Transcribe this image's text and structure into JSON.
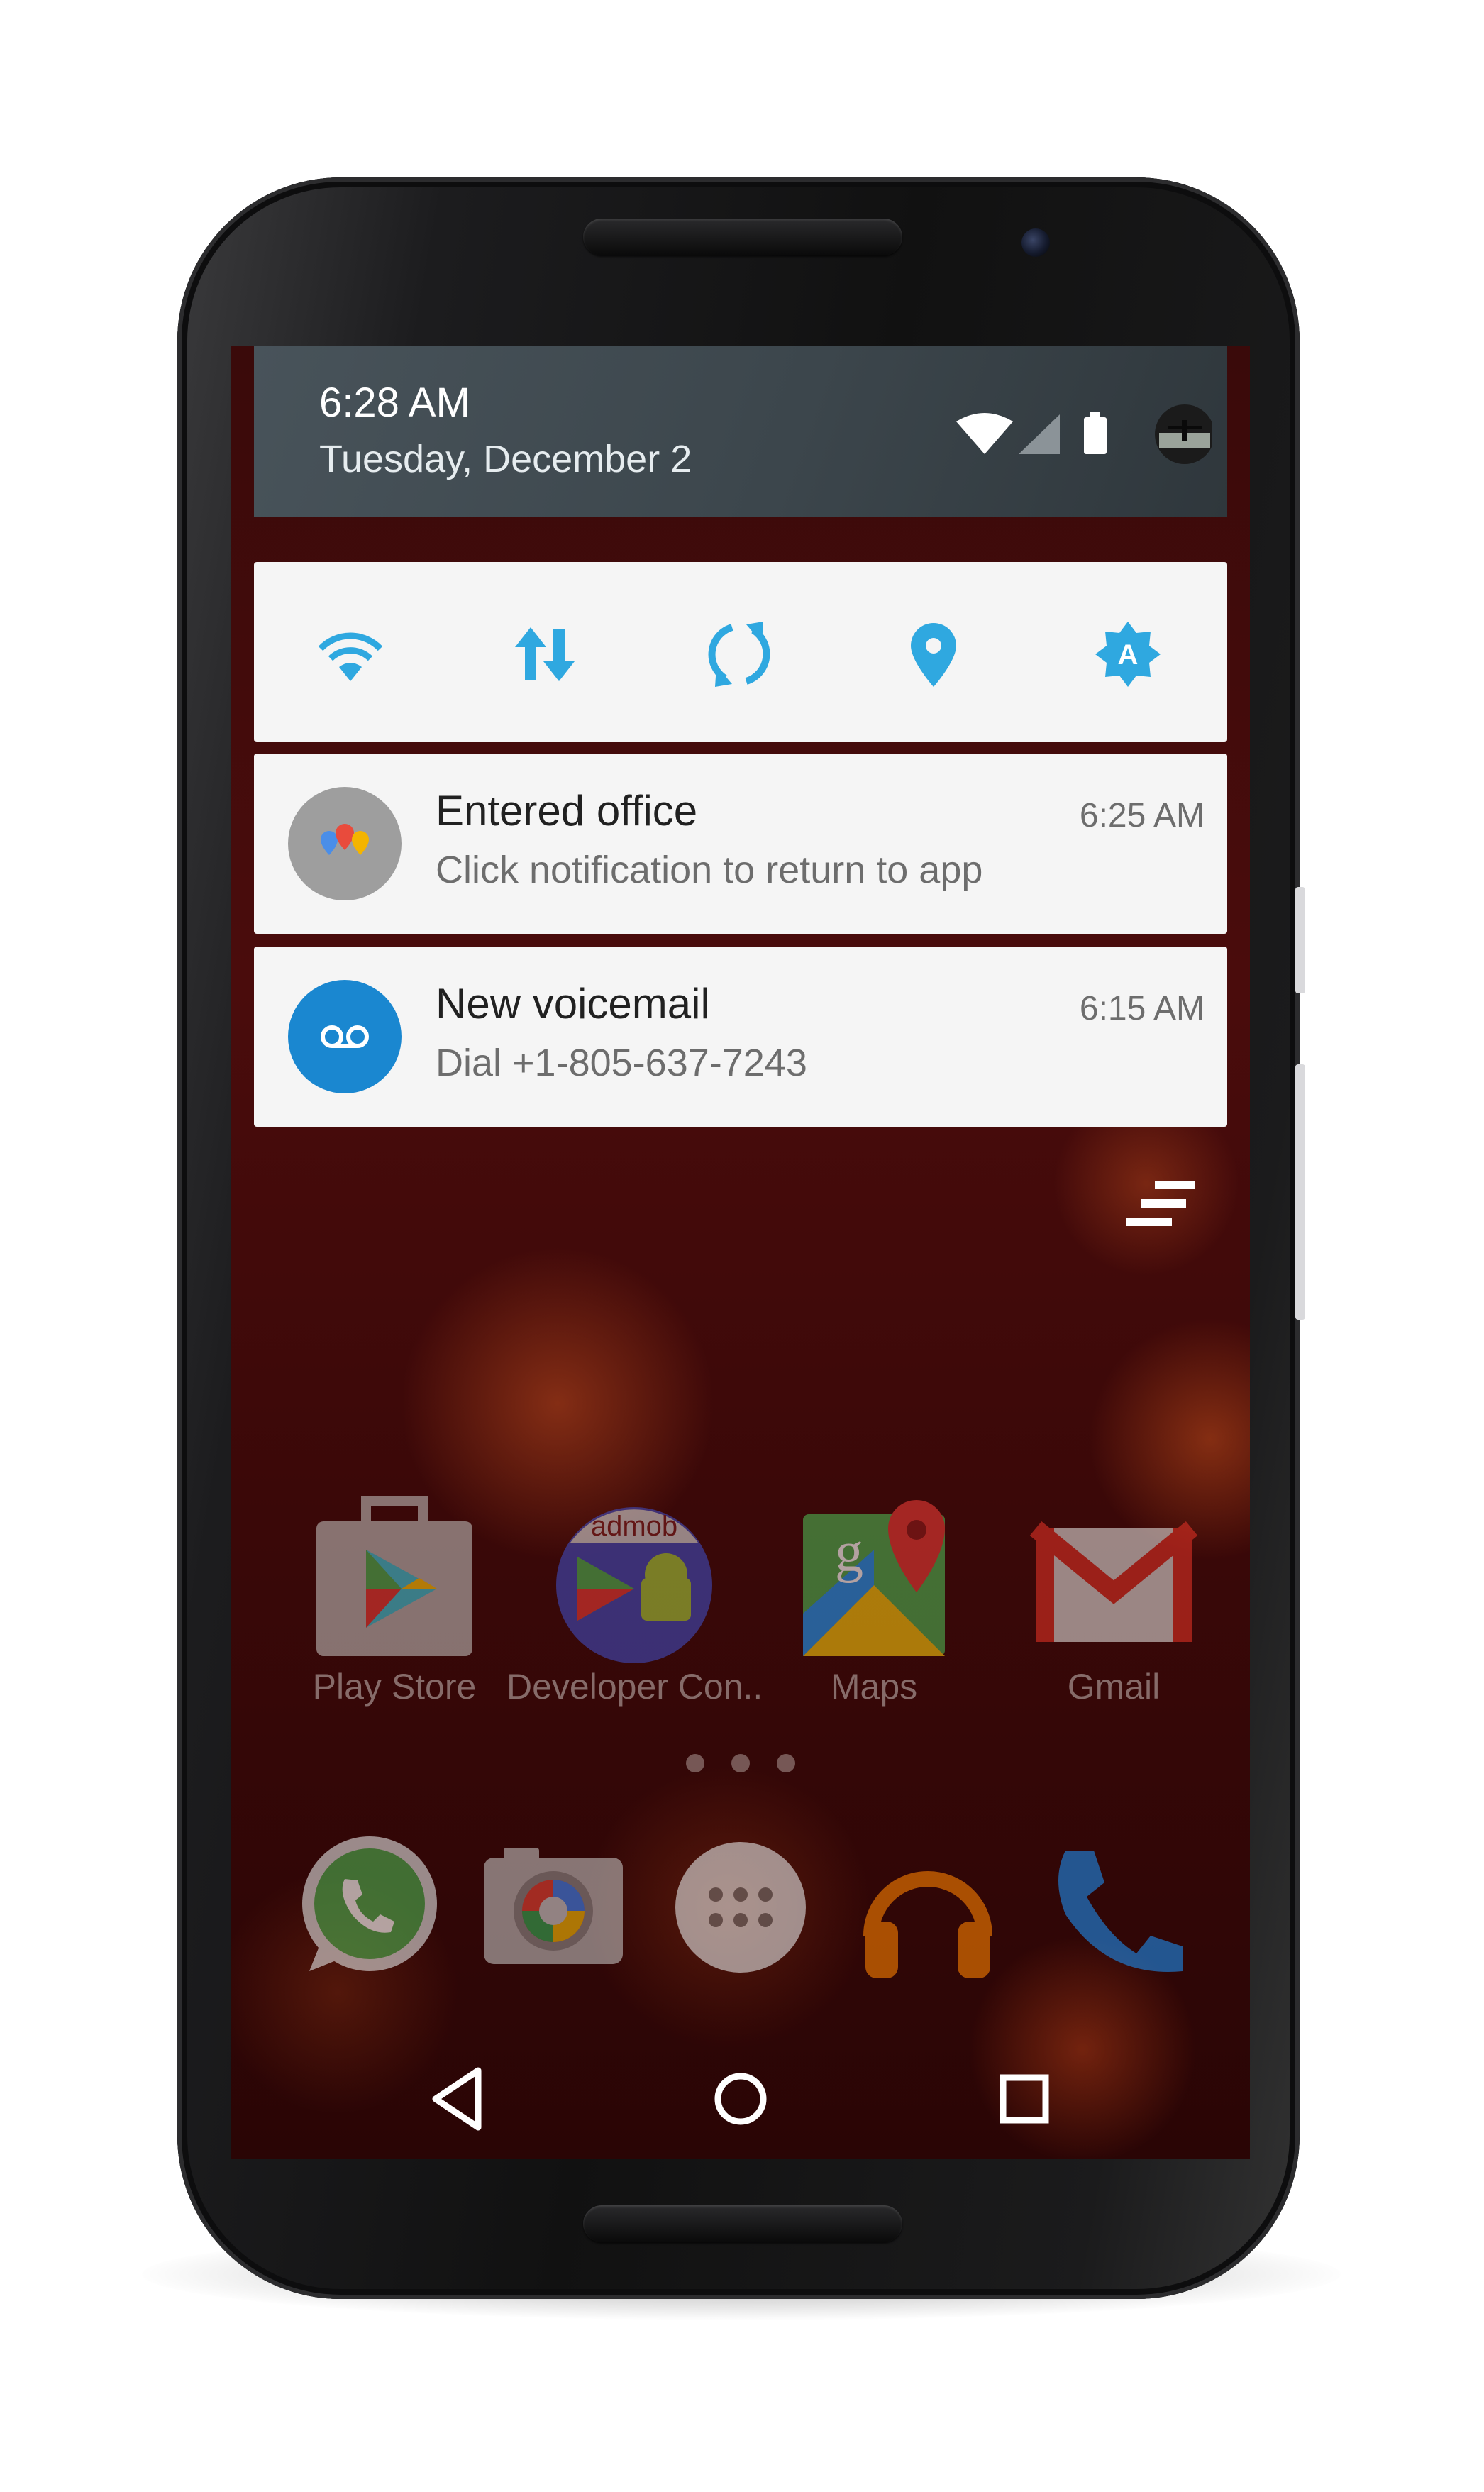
{
  "status_bar": {
    "time": "6:28 AM",
    "date": "Tuesday, December 2",
    "icons": [
      "wifi-icon",
      "signal-icon",
      "battery-icon",
      "profile-avatar"
    ]
  },
  "quick_settings": [
    {
      "name": "wifi",
      "icon": "wifi-icon"
    },
    {
      "name": "mobile-data",
      "icon": "data-arrows-icon"
    },
    {
      "name": "auto-rotate",
      "icon": "rotate-icon"
    },
    {
      "name": "location",
      "icon": "location-pin-icon"
    },
    {
      "name": "auto-brightness",
      "icon": "brightness-auto-icon"
    }
  ],
  "notifications": [
    {
      "title": "Entered office",
      "text": "Click notification to return to app",
      "time": "6:25 AM",
      "icon": "map-pins-icon"
    },
    {
      "title": "New voicemail",
      "text": "Dial +1-805-637-7243",
      "time": "6:15 AM",
      "icon": "voicemail-icon"
    }
  ],
  "home": {
    "apps": [
      {
        "label": "Play Store",
        "icon": "play-store-icon"
      },
      {
        "label": "Developer Con..",
        "icon": "admob-developer-console-icon",
        "badge": "admob"
      },
      {
        "label": "Maps",
        "icon": "maps-icon",
        "glyph": "g"
      },
      {
        "label": "Gmail",
        "icon": "gmail-icon"
      }
    ],
    "page_indicator_count": 3,
    "dock": [
      "whatsapp-icon",
      "camera-icon",
      "app-drawer-icon",
      "play-music-icon",
      "phone-icon"
    ]
  },
  "nav_bar": [
    "back-button",
    "home-button",
    "recents-button"
  ],
  "colors": {
    "accent": "#2fa8e0",
    "voicemail": "#1a87d0",
    "shade": "#3e484e",
    "card": "#f5f5f5"
  }
}
